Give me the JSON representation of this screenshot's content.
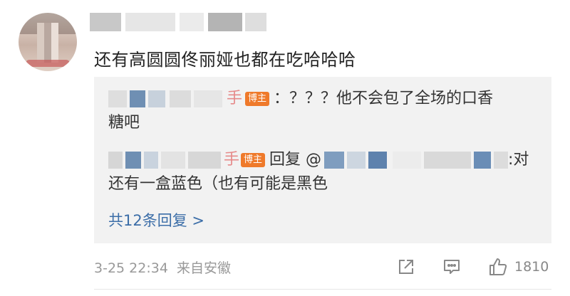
{
  "comment": {
    "text": "还有高圆圆佟丽娅也都在吃哈哈哈"
  },
  "replies": [
    {
      "badge": "博主",
      "text_line1": "：？？？他不会包了全场的口香",
      "text_line2": "糖吧"
    },
    {
      "badge": "博主",
      "reply_label": "回复 @",
      "text_tail": ":对",
      "text_line2": "还有一盒蓝色（也有可能是黑色"
    }
  ],
  "more_replies_label": "共12条回复 >",
  "footer": {
    "timestamp": "3-25 22:34",
    "source": "来自安徽",
    "like_count": "1810"
  },
  "colors": {
    "link": "#3c6ea8",
    "badge": "#ef7a2b",
    "reply_bg": "#f2f2f2",
    "meta": "#999999"
  },
  "icons": [
    "share-icon",
    "comment-icon",
    "like-icon"
  ]
}
